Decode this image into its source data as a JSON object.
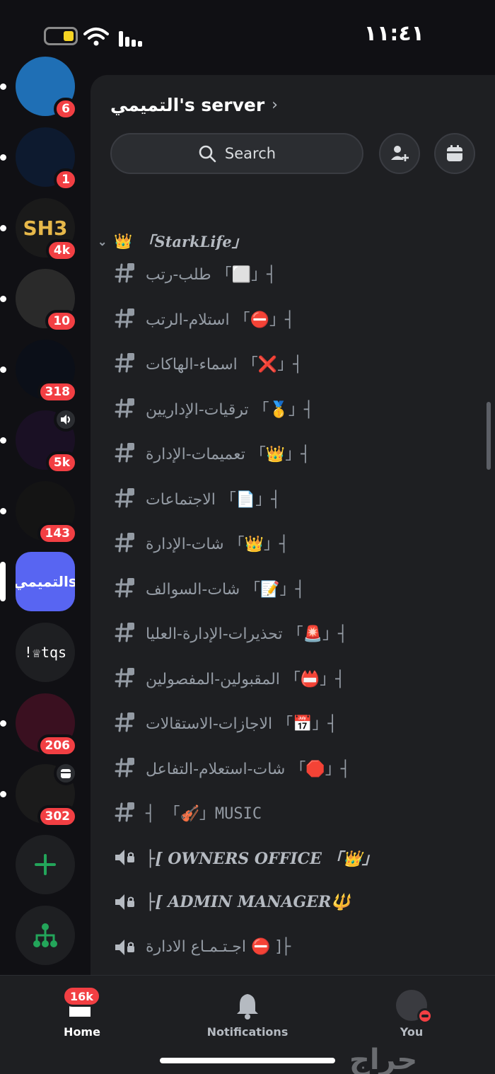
{
  "status_bar": {
    "time": "١١:٤١"
  },
  "servers": [
    {
      "name": "server-1",
      "badge": "6",
      "color": "#1f6fb5",
      "label": ""
    },
    {
      "name": "server-2",
      "badge": "1",
      "color": "#0d1a2f",
      "label": ""
    },
    {
      "name": "server-3",
      "badge": "4k",
      "color": "#1a1a1a",
      "label": "SH3"
    },
    {
      "name": "server-4",
      "badge": "10",
      "color": "#2a2a2a",
      "label": ""
    },
    {
      "name": "server-5",
      "badge": "318",
      "color": "#0b0f18",
      "label": ""
    },
    {
      "name": "server-6",
      "badge": "5k",
      "color": "#1a1024",
      "label": ""
    },
    {
      "name": "server-7",
      "badge": "143",
      "color": "#141414",
      "label": ""
    },
    {
      "name": "server-active",
      "badge": "",
      "color": "#5865f2",
      "label": "التميميs"
    },
    {
      "name": "server-9",
      "badge": "",
      "color": "#1e1f22",
      "label": "!♕tqs"
    },
    {
      "name": "server-10",
      "badge": "206",
      "color": "#3a1020",
      "label": ""
    },
    {
      "name": "server-11",
      "badge": "302",
      "color": "#1b1b1b",
      "label": ""
    }
  ],
  "header": {
    "server_name": "التميمي's server",
    "search_label": "Search"
  },
  "category": {
    "label": "「StarkLife」"
  },
  "channels": [
    {
      "name": "طلب-رتب 「⬜」┤",
      "type": "text"
    },
    {
      "name": "استلام-الرتب 「⛔」┤",
      "type": "text"
    },
    {
      "name": "اسماء-الهاكات 「❌」┤",
      "type": "text"
    },
    {
      "name": "ترقيات-الإداريين 「🥇」┤",
      "type": "text"
    },
    {
      "name": "تعميمات-الإدارة 「👑」┤",
      "type": "text"
    },
    {
      "name": "الاجتماعات 「📄」┤",
      "type": "text"
    },
    {
      "name": "شات-الإدارة 「👑」┤",
      "type": "text"
    },
    {
      "name": "شات-السوالف 「📝」┤",
      "type": "text"
    },
    {
      "name": "تحذيرات-الإدارة-العليا 「🚨」┤",
      "type": "text"
    },
    {
      "name": "المقبولين-المفصولين 「📛」┤",
      "type": "text"
    },
    {
      "name": "الاجازات-الاستقالات 「📅」┤",
      "type": "text"
    },
    {
      "name": "شات-استعلام-التفاعل 「🛑」┤",
      "type": "text"
    },
    {
      "name": "┤ 「🎻」MUSIC",
      "type": "text"
    },
    {
      "name": "├[ OWNERS OFFICE 「👑」",
      "type": "voice"
    },
    {
      "name": "├[ ADMIN MANAGER🔱",
      "type": "voice"
    },
    {
      "name": "اجـتـمـاع الادارة ⛔ ]├",
      "type": "voice"
    }
  ],
  "bottom_nav": {
    "home_label": "Home",
    "home_badge": "16k",
    "notifications_label": "Notifications",
    "you_label": "You"
  },
  "watermark": "حراج",
  "colors": {
    "accent": "#5865f2",
    "badge": "#f23f43",
    "add_server": "#23a55a"
  }
}
